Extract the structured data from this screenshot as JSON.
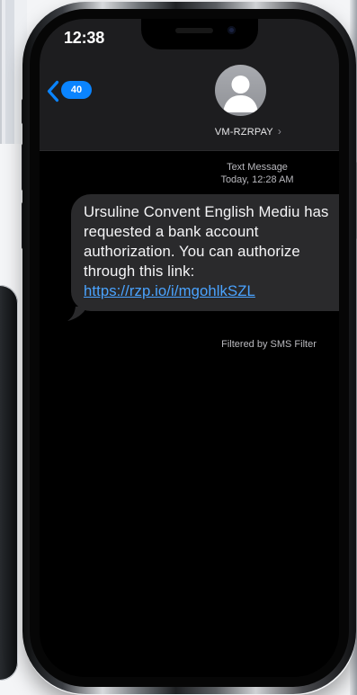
{
  "status_bar": {
    "time": "12:38"
  },
  "header": {
    "back_count": "40",
    "contact_name": "VM-RZRPAY",
    "contact_chevron": "›"
  },
  "conversation": {
    "label": "Text Message",
    "time": "Today, 12:28 AM"
  },
  "message": {
    "text": "Ursuline Convent English Mediu has requested a bank account authorization. You can authorize through this link: ",
    "link": "https://rzp.io/i/mgohlkSZL"
  },
  "footer": {
    "note": "Filtered by SMS Filter"
  },
  "colors": {
    "accent": "#0a84ff",
    "link": "#4aa3ff",
    "bubble": "#2a2a2c",
    "header": "#1d1d1f",
    "screen": "#000000"
  },
  "icons": {
    "back": "chevron-left-icon",
    "avatar": "person-icon"
  }
}
